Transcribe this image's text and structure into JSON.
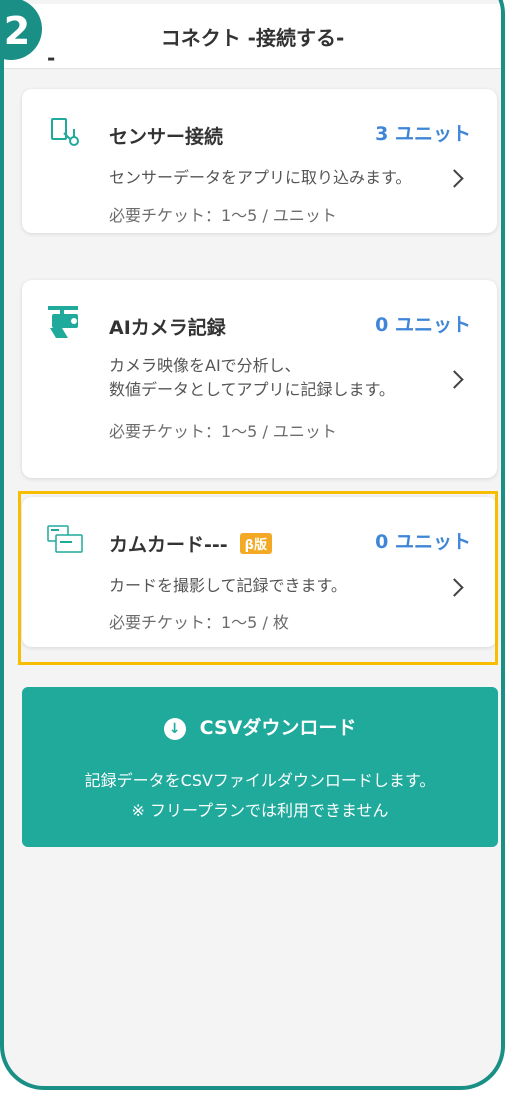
{
  "header": {
    "step_number": "2",
    "step_suffix": "-",
    "title": "コネクト -接続する-"
  },
  "cards": [
    {
      "icon": "sensor-icon",
      "title": "センサー接続",
      "units": "3 ユニット",
      "desc_line1": "センサーデータをアプリに取り込みます。",
      "desc_line2": "",
      "ticket": "必要チケット：1～5 / ユニット"
    },
    {
      "icon": "camera-icon",
      "title": "AIカメラ記録",
      "units": "0 ユニット",
      "desc_line1": "カメラ映像をAIで分析し、",
      "desc_line2": "数値データとしてアプリに記録します。",
      "ticket": "必要チケット：1～5 / ユニット"
    },
    {
      "icon": "card-camera-icon",
      "title": "カムカード---",
      "beta_label": "β版",
      "units": "0 ユニット",
      "desc_line1": "カードを撮影して記録できます。",
      "desc_line2": "",
      "ticket": "必要チケット：1～5 / 枚"
    }
  ],
  "csv": {
    "title": "CSVダウンロード",
    "description": "記録データをCSVファイルダウンロードします。",
    "note": "※ フリープランでは利用できません"
  },
  "colors": {
    "frame": "#1a8f86",
    "accent_blue": "#3f86d8",
    "csv_bg": "#1faa9c",
    "highlight": "#f7bd00",
    "beta": "#f3a923"
  }
}
